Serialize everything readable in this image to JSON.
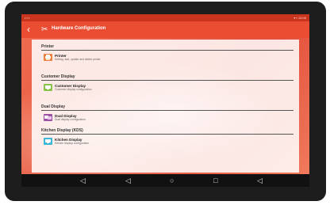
{
  "statusbar": {
    "left": "▪ ▪ ▪",
    "right": "▾ ▪ 12:00"
  },
  "appbar": {
    "back": "‹",
    "title": "Hardware Configuration"
  },
  "sections": [
    {
      "title": "Printer",
      "item": {
        "name": "Printer",
        "desc": "Setting, add, update and delete printer",
        "color": "#f0803c"
      }
    },
    {
      "title": "Customer Display",
      "item": {
        "name": "Customer Display",
        "desc": "Customer display configuration",
        "color": "#8bc34a"
      }
    },
    {
      "title": "Dual Display",
      "item": {
        "name": "Dual Display",
        "desc": "Dual display configuration",
        "color": "#9c4fa3"
      }
    },
    {
      "title": "Kitchen Display (KDS)",
      "item": {
        "name": "Kitchen Display",
        "desc": "Kitchen display configuration",
        "color": "#3db8d9"
      }
    }
  ],
  "navbar": {
    "volume_down": "◁",
    "back": "◁",
    "home": "○",
    "recents": "□",
    "volume_up": "◁"
  },
  "colors": {
    "accent": "#ea4d32",
    "statusbar": "#c9341f",
    "navbar": "#111111"
  }
}
